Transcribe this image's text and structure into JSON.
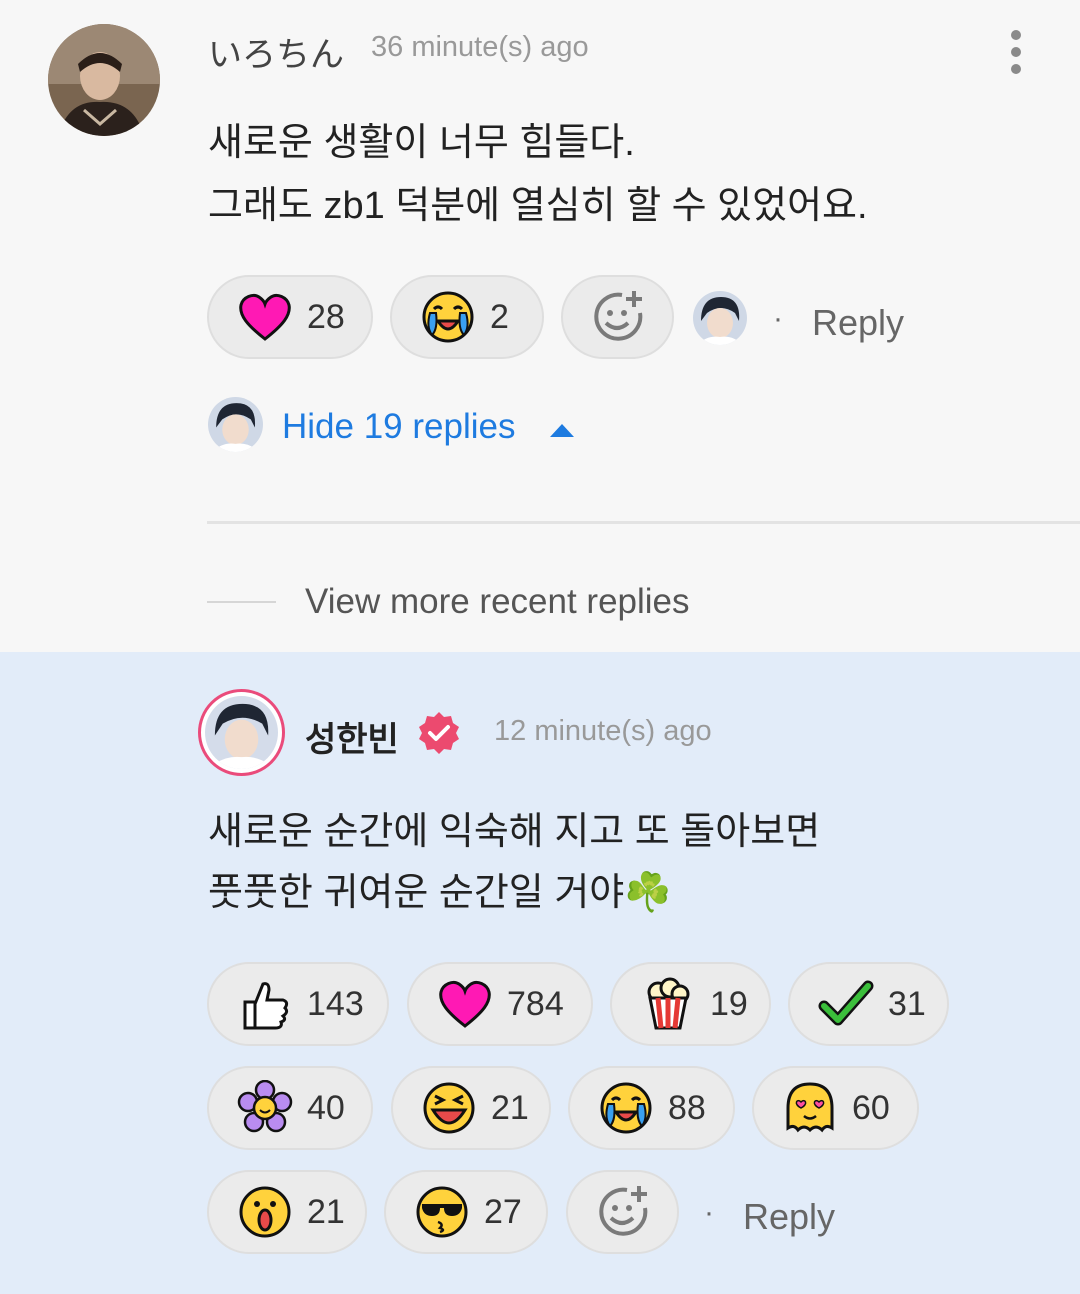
{
  "comment": {
    "username": "いろちん",
    "time": "36 minute(s) ago",
    "lines": [
      "새로운 생활이 너무 힘들다.",
      "그래도 zb1 덕분에 열심히 할 수 있었어요."
    ],
    "reactions": [
      {
        "icon": "heart-icon",
        "count": "28"
      },
      {
        "icon": "crying-face-icon",
        "count": "2"
      }
    ],
    "reply_label": "Reply",
    "dot": "·"
  },
  "replies_toggle": {
    "label": "Hide 19 replies"
  },
  "view_more": {
    "label": "View more recent replies"
  },
  "reply": {
    "username": "성한빈",
    "time": "12 minute(s) ago",
    "lines": [
      "새로운 순간에 익숙해 지고 또 돌아보면",
      "풋풋한 귀여운 순간일 거야☘️"
    ],
    "reactions": [
      {
        "icon": "thumbs-up-icon",
        "count": "143"
      },
      {
        "icon": "heart-icon",
        "count": "784"
      },
      {
        "icon": "popcorn-icon",
        "count": "19"
      },
      {
        "icon": "check-icon",
        "count": "31"
      },
      {
        "icon": "flower-icon",
        "count": "40"
      },
      {
        "icon": "laughing-face-icon",
        "count": "21"
      },
      {
        "icon": "crying-face-icon",
        "count": "88"
      },
      {
        "icon": "love-ghost-icon",
        "count": "60"
      },
      {
        "icon": "surprised-face-icon",
        "count": "21"
      },
      {
        "icon": "sunglasses-face-icon",
        "count": "27"
      }
    ],
    "reply_label": "Reply",
    "dot": "·"
  },
  "colors": {
    "link": "#1e7be0",
    "reply_background": "#e2ecf9",
    "verified_badge": "#ec4a6f",
    "heart": "#ff19b4"
  }
}
